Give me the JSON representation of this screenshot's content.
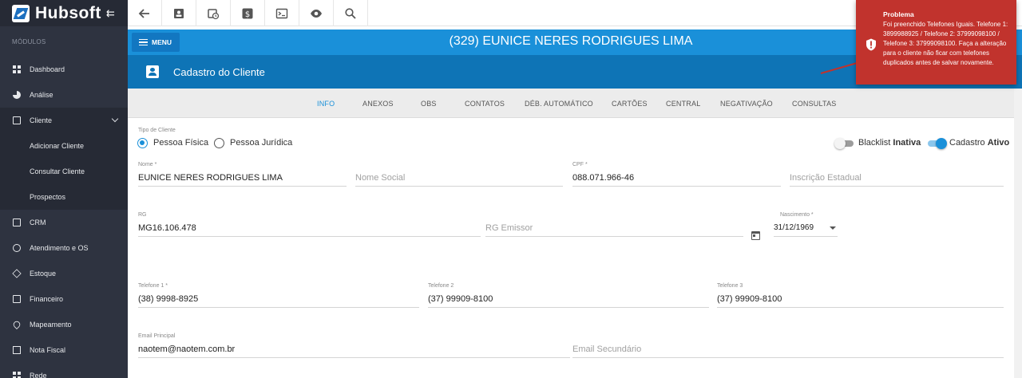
{
  "sidebar": {
    "brand": "Hubsoft",
    "section_label": "MÓDULOS",
    "items": [
      {
        "label": "Dashboard"
      },
      {
        "label": "Análise"
      },
      {
        "label": "Cliente"
      },
      {
        "label": "CRM"
      },
      {
        "label": "Atendimento e OS"
      },
      {
        "label": "Estoque"
      },
      {
        "label": "Financeiro"
      },
      {
        "label": "Mapeamento"
      },
      {
        "label": "Nota Fiscal"
      },
      {
        "label": "Rede"
      }
    ],
    "subitems": [
      {
        "label": "Adicionar Cliente"
      },
      {
        "label": "Consultar Cliente"
      },
      {
        "label": "Prospectos"
      }
    ]
  },
  "toolbar": {
    "buttons": [
      "back-arrow-icon",
      "contact-card-icon",
      "calendar-clock-icon",
      "dollar-icon",
      "terminal-icon",
      "eye-icon",
      "search-icon"
    ]
  },
  "header": {
    "menu_label": "MENU",
    "client_title": "(329) EUNICE NERES RODRIGUES LIMA",
    "section_title": "Cadastro do Cliente"
  },
  "tabs": [
    {
      "label": "INFO",
      "active": true
    },
    {
      "label": "ANEXOS"
    },
    {
      "label": "OBS"
    },
    {
      "label": "CONTATOS"
    },
    {
      "label": "DÉB. AUTOMÁTICO"
    },
    {
      "label": "CARTÕES"
    },
    {
      "label": "CENTRAL"
    },
    {
      "label": "NEGATIVAÇÃO"
    },
    {
      "label": "CONSULTAS"
    }
  ],
  "form": {
    "tipo_cliente_label": "Tipo de Cliente",
    "pessoa_fisica": "Pessoa Física",
    "pessoa_juridica": "Pessoa Jurídica",
    "blacklist_label": "Blacklist",
    "blacklist_state": "Inativa",
    "cadastro_label": "Cadastro",
    "cadastro_state": "Ativo",
    "nome_label": "Nome *",
    "nome_value": "EUNICE NERES RODRIGUES LIMA",
    "nome_social_ph": "Nome Social",
    "cpf_label": "CPF *",
    "cpf_value": "088.071.966-46",
    "inscricao_ph": "Inscrição Estadual",
    "rg_label": "RG",
    "rg_value": "MG16.106.478",
    "rg_emissor_ph": "RG Emissor",
    "nascimento_label": "Nascimento *",
    "nascimento_value": "31/12/1969",
    "tel1_label": "Telefone 1 *",
    "tel1_value": "(38) 9998-8925",
    "tel2_label": "Telefone 2",
    "tel2_value": "(37) 99909-8100",
    "tel3_label": "Telefone 3",
    "tel3_value": "(37) 99909-8100",
    "email_label": "Email Principal",
    "email_value": "naotem@naotem.com.br",
    "email_sec_ph": "Email Secundário"
  },
  "notification": {
    "title": "Problema",
    "message": "Foi preenchido Telefones Iguais. Telefone 1: 3899988925 / Telefone 2: 37999098100 / Telefone 3: 37999098100. Faça a alteração para o cliente não ficar com telefones duplicados antes de salvar novamente.",
    "color": "#c1332d"
  }
}
